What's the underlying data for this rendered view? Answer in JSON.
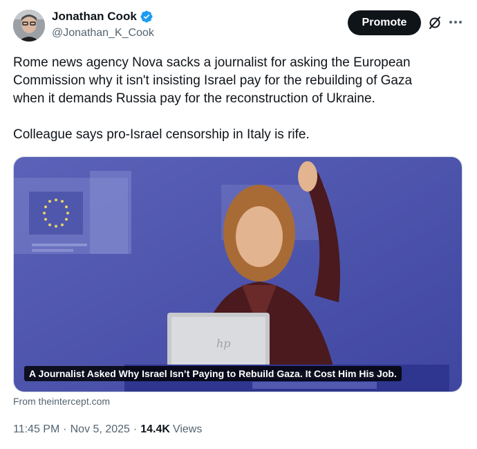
{
  "author": {
    "name": "Jonathan Cook",
    "handle": "@Jonathan_K_Cook",
    "verified": true
  },
  "actions": {
    "promote_label": "Promote"
  },
  "tweet": {
    "text": "Rome news agency Nova sacks a journalist for asking the European\nCommission why it isn't insisting Israel pay for the rebuilding of Gaza\nwhen it demands Russia pay for the reconstruction of Ukraine.\n\nColleague says pro-Israel censorship in Italy is rife."
  },
  "card": {
    "caption": "A Journalist Asked Why Israel Isn’t Paying to Rebuild Gaza. It Cost Him His Job.",
    "source": "From theintercept.com"
  },
  "meta": {
    "time": "11:45 PM",
    "date": "Nov 5, 2025",
    "views_count": "14.4K",
    "views_label": "Views",
    "separator": "·"
  },
  "colors": {
    "accent": "#1d9bf0",
    "text": "#0f1419",
    "muted": "#536471",
    "button_dark": "#0f1419"
  }
}
